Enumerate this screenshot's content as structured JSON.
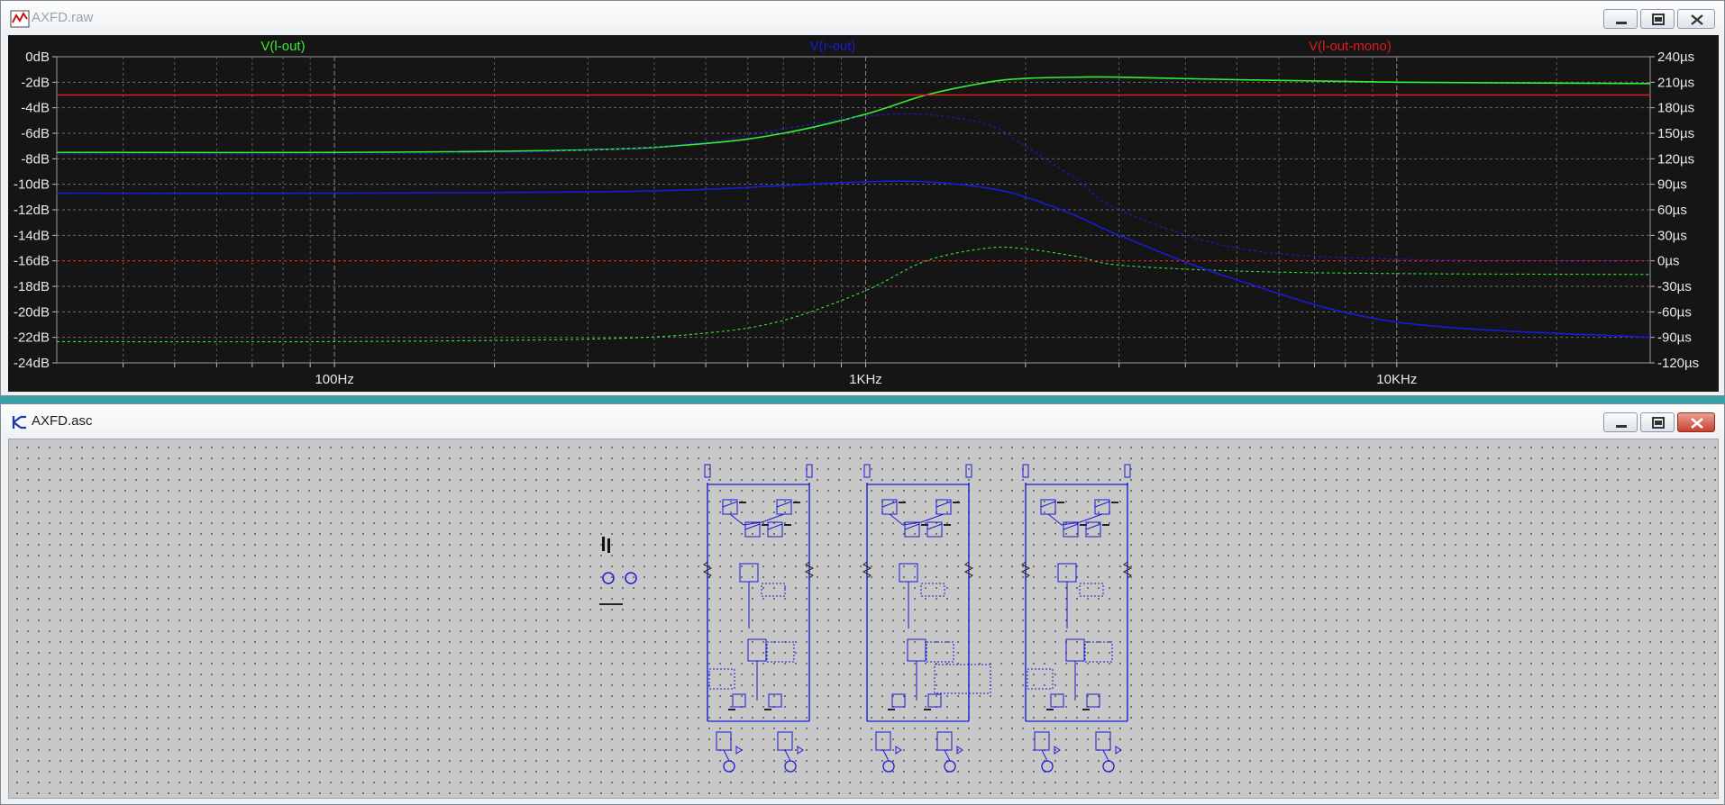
{
  "plot_window": {
    "title": "AXFD.raw",
    "icon": "waveform-icon",
    "traces": [
      {
        "label": "V(l-out)",
        "color": "#33ee33"
      },
      {
        "label": "V(r-out)",
        "color": "#1a1ad8"
      },
      {
        "label": "V(l-out-mono)",
        "color": "#e31a1a"
      }
    ],
    "left_axis_labels": [
      "0dB",
      "-2dB",
      "-4dB",
      "-6dB",
      "-8dB",
      "-10dB",
      "-12dB",
      "-14dB",
      "-16dB",
      "-18dB",
      "-20dB",
      "-22dB",
      "-24dB"
    ],
    "right_axis_labels": [
      "240µs",
      "210µs",
      "180µs",
      "150µs",
      "120µs",
      "90µs",
      "60µs",
      "30µs",
      "0µs",
      "-30µs",
      "-60µs",
      "-90µs",
      "-120µs"
    ],
    "x_axis_labels": [
      "100Hz",
      "1KHz",
      "10KHz"
    ]
  },
  "chart_data": {
    "type": "line",
    "x_scale": "log",
    "xlim": [
      30,
      30000
    ],
    "ylim_left": [
      -24,
      0
    ],
    "ylim_right": [
      -120,
      240
    ],
    "grid": true,
    "series": [
      {
        "name": "V(l-out)",
        "axis": "magnitude_dB",
        "style": "solid",
        "color": "#33ee33",
        "x": [
          30,
          100,
          300,
          500,
          700,
          1000,
          1300,
          1700,
          2000,
          2500,
          3000,
          5000,
          10000,
          30000
        ],
        "y": [
          -7.5,
          -7.5,
          -7.3,
          -6.8,
          -6.0,
          -4.5,
          -3.0,
          -2.0,
          -1.7,
          -1.6,
          -1.6,
          -1.8,
          -2.0,
          -2.1
        ]
      },
      {
        "name": "V(l-out)",
        "axis": "group_delay_us",
        "style": "dashed",
        "color": "#33ee33",
        "x": [
          30,
          100,
          300,
          500,
          700,
          1000,
          1300,
          1700,
          2000,
          2500,
          3000,
          5000,
          10000,
          30000
        ],
        "y": [
          -95,
          -95,
          -92,
          -85,
          -70,
          -35,
          0,
          15,
          14,
          5,
          -5,
          -12,
          -15,
          -16
        ]
      },
      {
        "name": "V(r-out)",
        "axis": "magnitude_dB",
        "style": "solid",
        "color": "#1a1ad8",
        "x": [
          30,
          100,
          300,
          500,
          700,
          1000,
          1300,
          1700,
          2000,
          2500,
          3000,
          5000,
          10000,
          30000
        ],
        "y": [
          -10.7,
          -10.7,
          -10.6,
          -10.4,
          -10.1,
          -9.8,
          -9.8,
          -10.3,
          -11.0,
          -12.5,
          -14.0,
          -17.5,
          -20.8,
          -22.0
        ]
      },
      {
        "name": "V(r-out)",
        "axis": "group_delay_us",
        "style": "dashed",
        "color": "#1a1ad8",
        "x": [
          30,
          100,
          300,
          500,
          700,
          1000,
          1300,
          1700,
          2000,
          2500,
          3000,
          5000,
          10000,
          30000
        ],
        "y": [
          125,
          125,
          130,
          140,
          155,
          170,
          172,
          160,
          135,
          95,
          60,
          15,
          2,
          0
        ]
      },
      {
        "name": "V(l-out-mono)",
        "axis": "magnitude_dB",
        "style": "solid",
        "color": "#e31a1a",
        "x": [
          30,
          30000
        ],
        "y": [
          -3.0,
          -3.0
        ]
      },
      {
        "name": "V(l-out-mono)",
        "axis": "group_delay_us",
        "style": "dashed",
        "color": "#e31a1a",
        "x": [
          30,
          30000
        ],
        "y": [
          0,
          0
        ]
      }
    ]
  },
  "schematic_window": {
    "title": "AXFD.asc",
    "icon": "schematic-icon"
  },
  "window_buttons": {
    "minimize": "minimize-icon",
    "restore": "restore-icon",
    "close": "close-icon"
  }
}
